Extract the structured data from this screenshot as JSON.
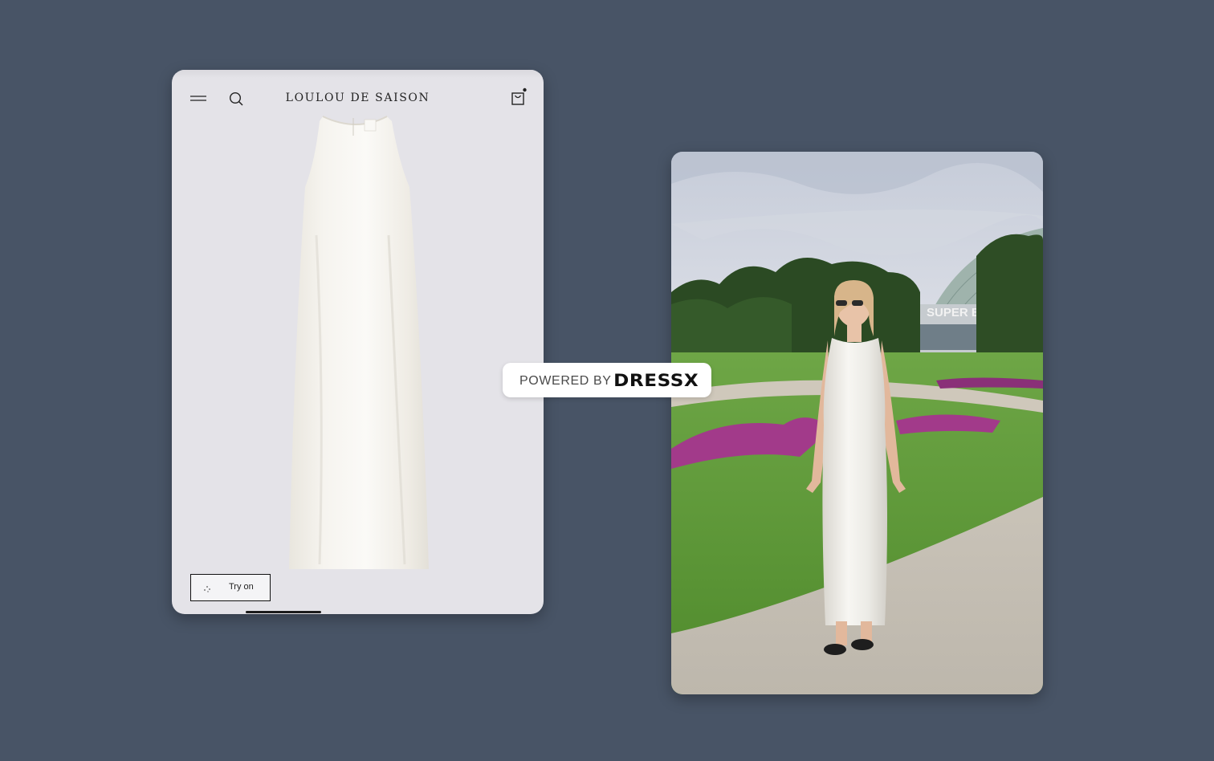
{
  "product_page": {
    "brand": "LOULOU DE SAISON",
    "try_on_label": "Try on",
    "icons": {
      "menu": "menu-icon",
      "search": "search-icon",
      "cart": "cart-icon",
      "try_on": "sparkle-icon"
    },
    "colors": {
      "page_bg": "#e4e3e8",
      "dress": "#f2f0ea"
    }
  },
  "badge": {
    "prefix": "POWERED BY",
    "brand": "DRESSX"
  },
  "photo_sign_text": "SUPER BOCK",
  "colors": {
    "background": "#485466"
  }
}
